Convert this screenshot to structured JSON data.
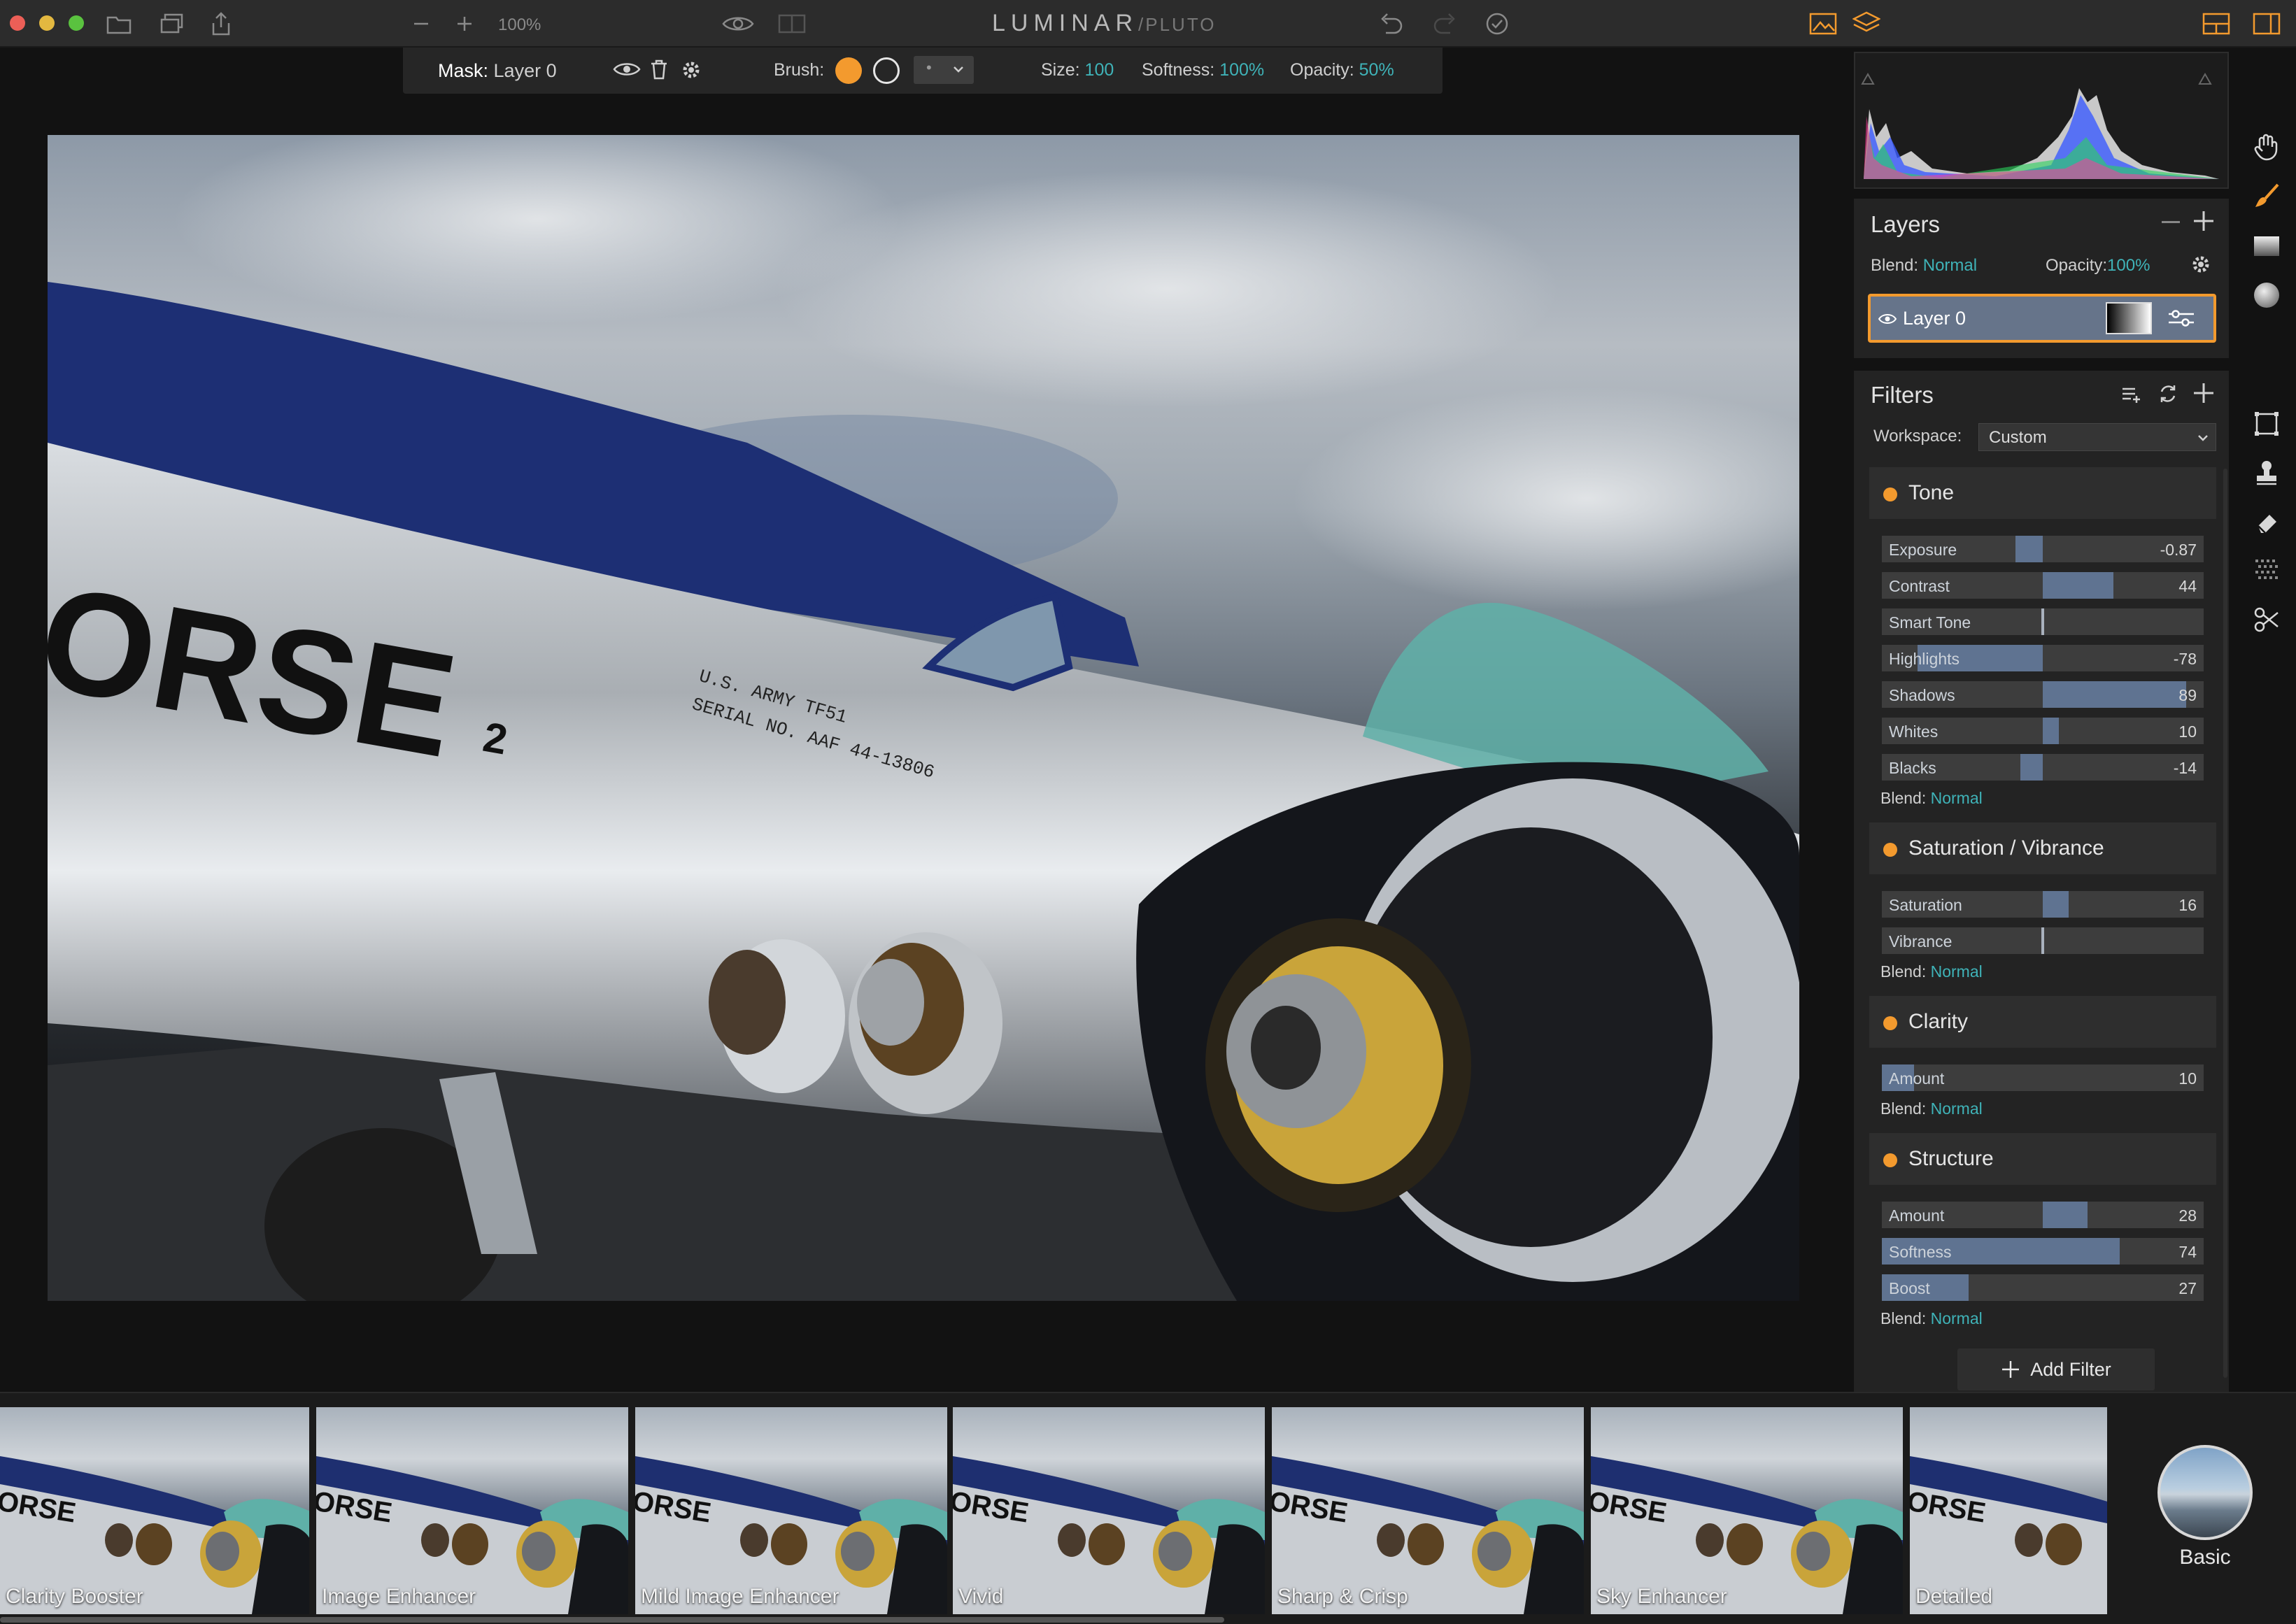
{
  "app": {
    "title": "LUMINAR",
    "subtitle": "/PLUTO",
    "zoom": "100%"
  },
  "mask_toolbar": {
    "mask_label": "Mask:",
    "mask_layer": "Layer 0",
    "brush_label": "Brush:",
    "size_label": "Size:",
    "size_value": "100",
    "softness_label": "Softness:",
    "softness_value": "100%",
    "opacity_label": "Opacity:",
    "opacity_value": "50%"
  },
  "layers": {
    "title": "Layers",
    "blend_label": "Blend:",
    "blend_value": "Normal",
    "opacity_label": "Opacity:",
    "opacity_value": "100%",
    "items": [
      {
        "name": "Layer 0"
      }
    ]
  },
  "filters": {
    "title": "Filters",
    "workspace_label": "Workspace:",
    "workspace_value": "Custom",
    "sections": [
      {
        "name": "Tone",
        "sliders": [
          {
            "name": "Exposure",
            "value": "-0.87",
            "level": -0.17
          },
          {
            "name": "Contrast",
            "value": "44",
            "level": 0.44
          },
          {
            "name": "Smart Tone",
            "value": "",
            "level": 0
          },
          {
            "name": "Highlights",
            "value": "-78",
            "level": -0.78
          },
          {
            "name": "Shadows",
            "value": "89",
            "level": 0.89
          },
          {
            "name": "Whites",
            "value": "10",
            "level": 0.1
          },
          {
            "name": "Blacks",
            "value": "-14",
            "level": -0.14
          }
        ],
        "blend_label": "Blend:",
        "blend_value": "Normal"
      },
      {
        "name": "Saturation / Vibrance",
        "sliders": [
          {
            "name": "Saturation",
            "value": "16",
            "level": 0.16
          },
          {
            "name": "Vibrance",
            "value": "",
            "level": 0
          }
        ],
        "blend_label": "Blend:",
        "blend_value": "Normal"
      },
      {
        "name": "Clarity",
        "sliders": [
          {
            "name": "Amount",
            "value": "10",
            "level": 0.1,
            "unipolar": true
          }
        ],
        "blend_label": "Blend:",
        "blend_value": "Normal"
      },
      {
        "name": "Structure",
        "sliders": [
          {
            "name": "Amount",
            "value": "28",
            "level": 0.28
          },
          {
            "name": "Softness",
            "value": "74",
            "level": 0.74,
            "unipolar": true
          },
          {
            "name": "Boost",
            "value": "27",
            "level": 0.27,
            "unipolar": true
          }
        ],
        "blend_label": "Blend:",
        "blend_value": "Normal"
      }
    ],
    "add_filter_label": "Add Filter"
  },
  "presets": {
    "items": [
      "Clarity Booster",
      "Image Enhancer",
      "Mild Image Enhancer",
      "Vivid",
      "Sharp & Crisp",
      "Sky Enhancer",
      "Detailed"
    ],
    "category": "Basic"
  },
  "photo": {
    "lettering": "ORSE",
    "superscript": "2",
    "stencil_line1": "U.S. ARMY TF51",
    "stencil_line2": "SERIAL NO. AAF 44-13806"
  },
  "colors": {
    "accent_orange": "#f39a2e",
    "accent_teal": "#3fb3b8",
    "slider_fill": "#5f7391",
    "layer_selected": "#66748a"
  },
  "icons": [
    "close-icon",
    "minimize-icon",
    "zoom-icon",
    "folder-icon",
    "copy-icon",
    "share-icon",
    "zoom-out-icon",
    "zoom-in-icon",
    "eye-icon",
    "compare-icon",
    "undo-icon",
    "redo-icon",
    "check-icon",
    "image-icon",
    "layers-icon",
    "layout-icon",
    "sidebar-icon",
    "hand-icon",
    "brush-icon",
    "gradient-icon",
    "radial-icon",
    "crop-icon",
    "stamp-icon",
    "eraser-icon",
    "noise-icon",
    "scissors-icon"
  ]
}
